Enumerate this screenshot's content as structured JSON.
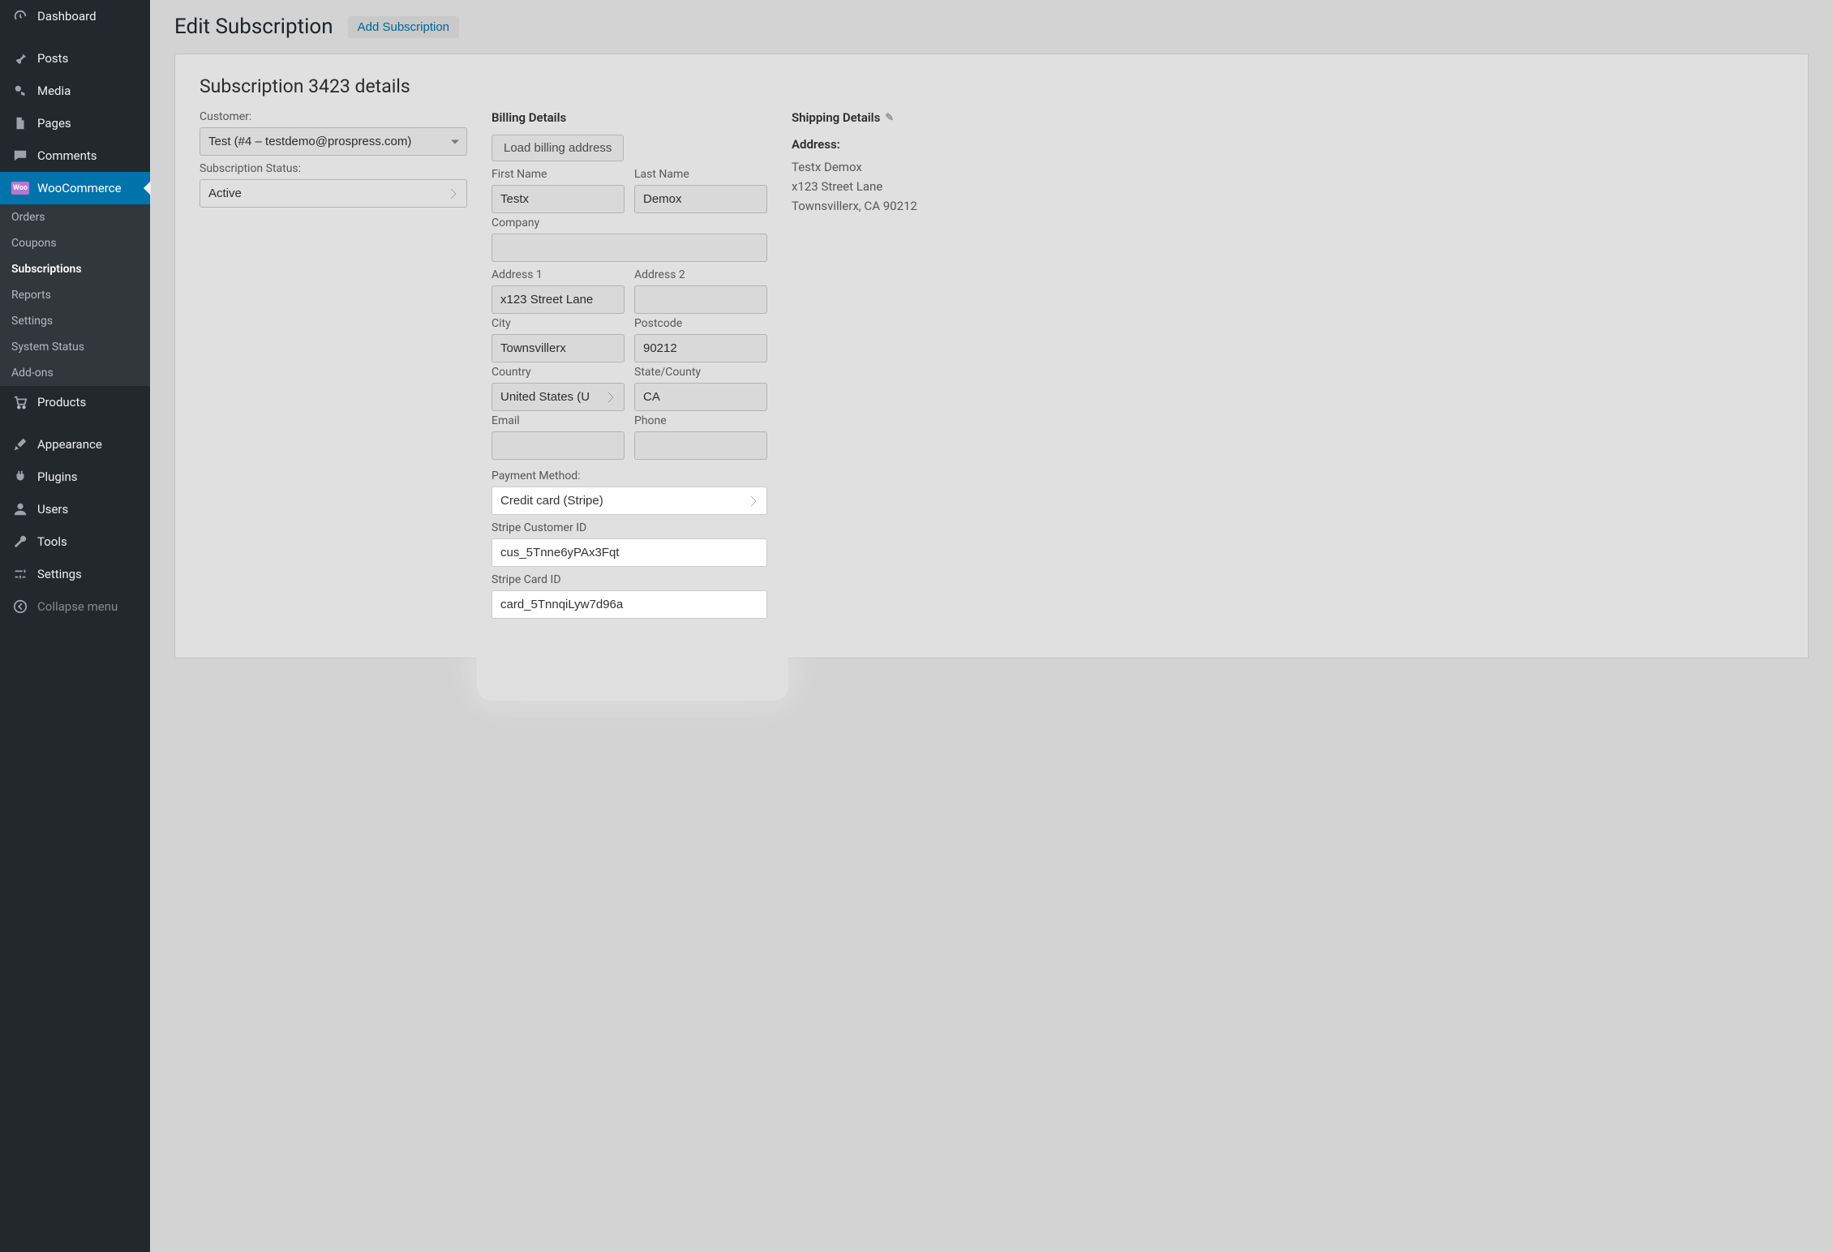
{
  "sidebar": {
    "dashboard": "Dashboard",
    "posts": "Posts",
    "media": "Media",
    "pages": "Pages",
    "comments": "Comments",
    "woocommerce": "WooCommerce",
    "woo_sub": {
      "orders": "Orders",
      "coupons": "Coupons",
      "subscriptions": "Subscriptions",
      "reports": "Reports",
      "settings": "Settings",
      "system_status": "System Status",
      "addons": "Add-ons"
    },
    "products": "Products",
    "appearance": "Appearance",
    "plugins": "Plugins",
    "users": "Users",
    "tools": "Tools",
    "settings": "Settings",
    "collapse": "Collapse menu"
  },
  "header": {
    "title": "Edit Subscription",
    "add_btn": "Add Subscription"
  },
  "panel": {
    "title": "Subscription 3423 details",
    "customer_label": "Customer:",
    "customer_value": "Test (#4 – testdemo@prospress.com)",
    "status_label": "Subscription Status:",
    "status_value": "Active"
  },
  "billing": {
    "heading": "Billing Details",
    "load_btn": "Load billing address",
    "first_name_label": "First Name",
    "first_name": "Testx",
    "last_name_label": "Last Name",
    "last_name": "Demox",
    "company_label": "Company",
    "company": "",
    "address1_label": "Address 1",
    "address1": "x123 Street Lane",
    "address2_label": "Address 2",
    "address2": "",
    "city_label": "City",
    "city": "Townsvillerx",
    "postcode_label": "Postcode",
    "postcode": "90212",
    "country_label": "Country",
    "country": "United States (U",
    "state_label": "State/County",
    "state": "CA",
    "email_label": "Email",
    "email": "",
    "phone_label": "Phone",
    "phone": ""
  },
  "payment": {
    "method_label": "Payment Method:",
    "method_value": "Credit card (Stripe)",
    "cust_id_label": "Stripe Customer ID",
    "cust_id": "cus_5Tnne6yPAx3Fqt",
    "card_id_label": "Stripe Card ID",
    "card_id": "card_5TnnqiLyw7d96a"
  },
  "shipping": {
    "heading": "Shipping Details",
    "address_label": "Address:",
    "line1": "Testx Demox",
    "line2": "x123 Street Lane",
    "line3": "Townsvillerx, CA 90212"
  }
}
